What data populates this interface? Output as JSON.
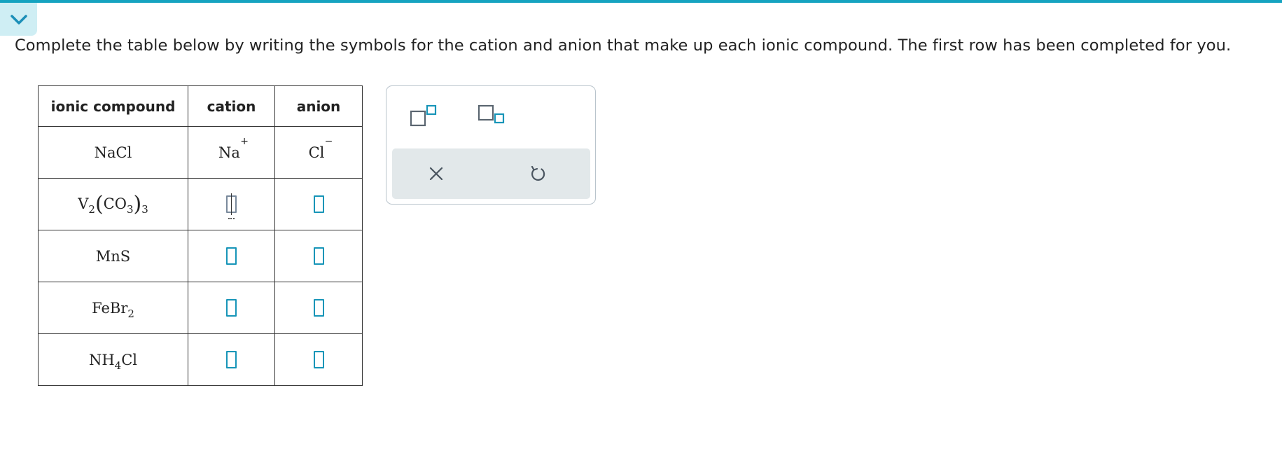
{
  "instructions": "Complete the table below by writing the symbols for the cation and anion that make up each ionic compound. The first row has been completed for you.",
  "table": {
    "headers": [
      "ionic compound",
      "cation",
      "anion"
    ],
    "rows": [
      {
        "compound": {
          "parts": [
            "NaCl"
          ]
        },
        "cation": {
          "symbol": "Na",
          "charge": "+"
        },
        "anion": {
          "symbol": "Cl",
          "charge": "−"
        }
      },
      {
        "compound": {
          "parts": [
            "V",
            "2",
            "(",
            "CO",
            "3",
            ")",
            "3"
          ]
        },
        "cation": {
          "value": "",
          "active": true
        },
        "anion": {
          "value": ""
        }
      },
      {
        "compound": {
          "parts": [
            "MnS"
          ]
        },
        "cation": {
          "value": ""
        },
        "anion": {
          "value": ""
        }
      },
      {
        "compound": {
          "parts": [
            "FeBr",
            "2"
          ]
        },
        "cation": {
          "value": ""
        },
        "anion": {
          "value": ""
        }
      },
      {
        "compound": {
          "parts": [
            "NH",
            "4",
            "Cl"
          ]
        },
        "cation": {
          "value": ""
        },
        "anion": {
          "value": ""
        }
      }
    ]
  },
  "toolbox": {
    "tools": [
      "superscript-tool-icon",
      "subscript-tool-icon"
    ],
    "actions": [
      "close-icon",
      "undo-icon"
    ]
  },
  "colors": {
    "accent": "#15a3c0",
    "input_border": "#1795b8",
    "action_bar_bg": "#e2e8ea"
  }
}
